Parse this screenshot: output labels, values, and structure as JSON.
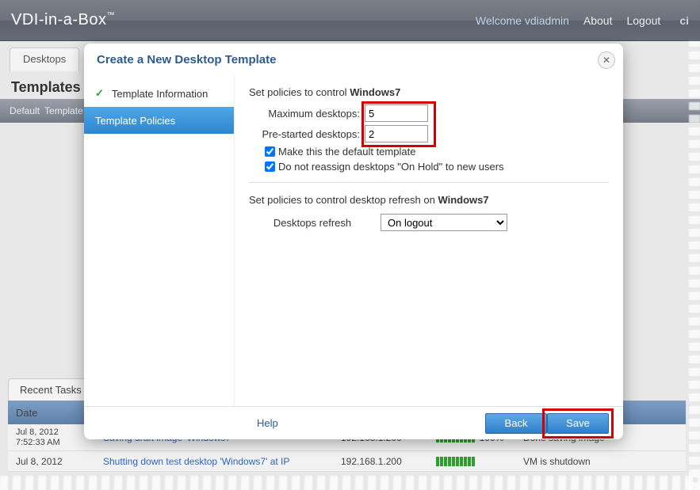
{
  "header": {
    "brand": "VDI-in-a-Box",
    "tm": "™",
    "welcome": "Welcome vdiadmin",
    "about": "About",
    "logout": "Logout",
    "ci": "ci"
  },
  "tabs": {
    "desktops": "Desktops"
  },
  "page": {
    "title": "Templates",
    "sub_default": "Default",
    "sub_template": "Template"
  },
  "recent": {
    "tab": "Recent Tasks",
    "head_date": "Date",
    "rows": [
      {
        "date": "Jul 8, 2012",
        "time": "7:52:33 AM",
        "task": "Saving draft image 'Windows7'",
        "ip": "192.168.1.200",
        "progress": "100%",
        "status": "Done saving image"
      },
      {
        "date": "Jul 8, 2012",
        "time": "",
        "task": "Shutting down test desktop 'Windows7' at IP",
        "ip": "192.168.1.200",
        "progress": "",
        "status": "VM is shutdown"
      }
    ]
  },
  "modal": {
    "title": "Create a New Desktop Template",
    "side": {
      "info": "Template Information",
      "policies": "Template Policies"
    },
    "policies": {
      "intro_prefix": "Set policies to control ",
      "intro_target": "Windows7",
      "max_label": "Maximum desktops:",
      "max_value": "5",
      "prestart_label": "Pre-started desktops:",
      "prestart_value": "2",
      "make_default": "Make this the default template",
      "no_reassign": "Do not reassign desktops \"On Hold\" to new users",
      "refresh_intro_prefix": "Set policies to control desktop refresh on ",
      "refresh_intro_target": "Windows7",
      "refresh_label": "Desktops refresh",
      "refresh_value": "On logout"
    },
    "footer": {
      "help": "Help",
      "back": "Back",
      "save": "Save"
    }
  }
}
